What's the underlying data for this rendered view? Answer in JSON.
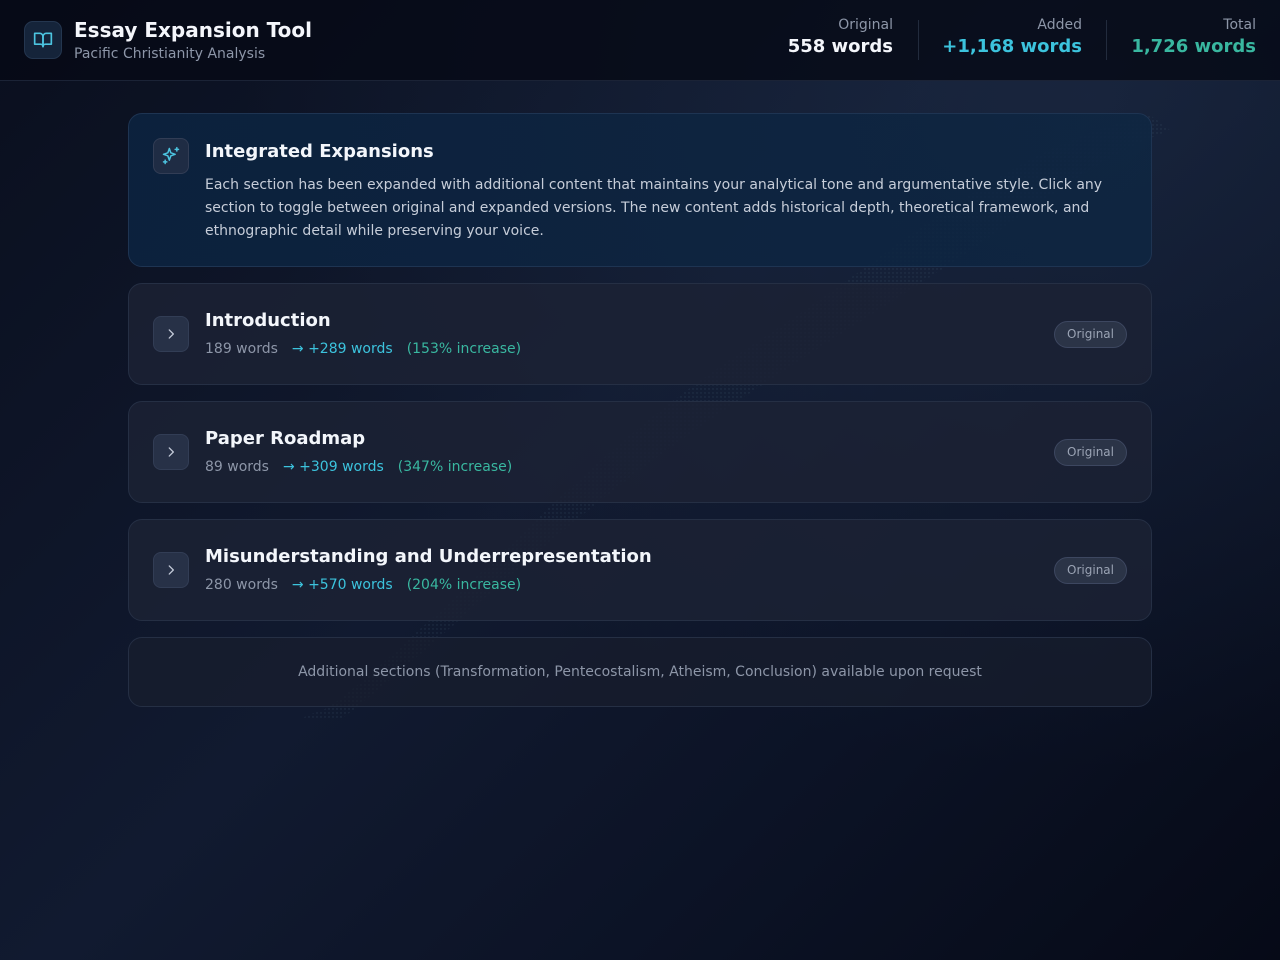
{
  "header": {
    "title": "Essay Expansion Tool",
    "subtitle": "Pacific Christianity Analysis",
    "logo_icon": "book-open-icon",
    "stats": [
      {
        "label": "Original",
        "value": "558 words",
        "color": "#ffffff"
      },
      {
        "label": "Added",
        "value": "+1,168 words",
        "color": "#3cc3dd"
      },
      {
        "label": "Total",
        "value": "1,726 words",
        "color": "#39b7a0"
      }
    ]
  },
  "info": {
    "icon": "sparkles-icon",
    "title": "Integrated Expansions",
    "body": "Each section has been expanded with additional content that maintains your analytical tone and argumentative style. Click any section to toggle between original and expanded versions. The new content adds historical depth, theoretical framework, and ethnographic detail while preserving your voice."
  },
  "sections": [
    {
      "title": "Introduction",
      "original": "189 words",
      "added": "→ +289 words",
      "increase": "(153% increase)",
      "badge": "Original"
    },
    {
      "title": "Paper Roadmap",
      "original": "89 words",
      "added": "→ +309 words",
      "increase": "(347% increase)",
      "badge": "Original"
    },
    {
      "title": "Misunderstanding and Underrepresentation",
      "original": "280 words",
      "added": "→ +570 words",
      "increase": "(204% increase)",
      "badge": "Original"
    }
  ],
  "footer_note": "Additional sections (Transformation, Pentecostalism, Atheism, Conclusion) available upon request",
  "colors": {
    "accent_cyan": "#3cc3dd",
    "accent_teal": "#39b7a0",
    "background": "#0b1122"
  }
}
